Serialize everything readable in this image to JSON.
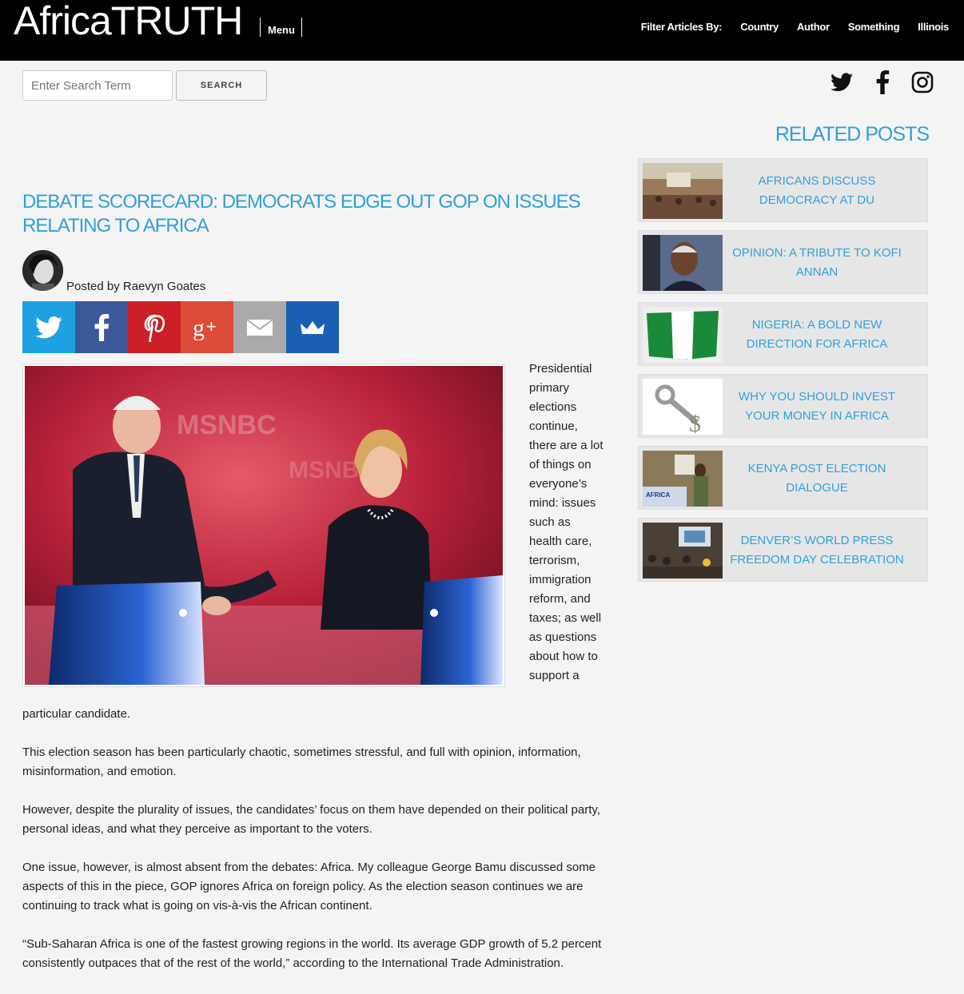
{
  "header": {
    "logo": "AfricaTRUTH",
    "menu_label": "Menu",
    "filter_label": "Filter Articles By:",
    "filters": [
      "Country",
      "Author",
      "Something",
      "Illinois"
    ]
  },
  "search": {
    "placeholder": "Enter Search Term",
    "button_label": "SEARCH"
  },
  "social_top": [
    "twitter-icon",
    "facebook-icon",
    "instagram-icon"
  ],
  "article": {
    "title": "DEBATE SCORECARD: DEMOCRATS EDGE OUT GOP ON ISSUES RELATING TO AFRICA",
    "byline": "Posted by Raevyn Goates",
    "share_buttons": [
      {
        "icon": "twitter-icon",
        "color": "#1da1e2"
      },
      {
        "icon": "facebook-icon",
        "color": "#3b5998"
      },
      {
        "icon": "pinterest-icon",
        "color": "#cb2027"
      },
      {
        "icon": "google-plus-icon",
        "color": "#dd4b39"
      },
      {
        "icon": "email-icon",
        "color": "#aaaaaa"
      },
      {
        "icon": "crown-icon",
        "color": "#1a5fb4"
      }
    ],
    "float_paragraph": "Presidential primary elections continue, there are a lot of things on everyone’s mind: issues such as health care, terrorism, immigration reform, and taxes; as well as questions about how to support a",
    "float_continuation": "particular candidate.",
    "paragraphs": [
      "This election season has been particularly chaotic, sometimes stressful, and full with opinion, information, misinformation, and emotion.",
      "However, despite the plurality of issues, the candidates’ focus on them have depended on their political party, personal ideas, and what they perceive as important to the voters.",
      "One issue, however, is almost absent from the debates: Africa. My colleague George Bamu discussed some aspects of this in the piece, GOP ignores Africa on foreign policy. As the election season continues we are continuing to track what is going on vis-à-vis the African continent.",
      "“Sub-Saharan Africa is one of the fastest growing regions in the world. Its average GDP growth of 5.2 percent consistently outpaces that of the rest of the world,” according to the International Trade Administration."
    ]
  },
  "sidebar": {
    "title": "RELATED POSTS",
    "posts": [
      {
        "title": "AFRICANS DISCUSS DEMOCRACY AT DU"
      },
      {
        "title": "OPINION: A TRIBUTE TO KOFI ANNAN"
      },
      {
        "title": "NIGERIA: A BOLD NEW DIRECTION FOR AFRICA"
      },
      {
        "title": "WHY YOU SHOULD INVEST YOUR MONEY IN AFRICA"
      },
      {
        "title": "KENYA POST ELECTION DIALOGUE"
      },
      {
        "title": "DENVER’S WORLD PRESS FREEDOM DAY CELEBRATION"
      }
    ]
  },
  "colors": {
    "accent": "#30a0d8",
    "header_bg": "#000000",
    "page_bg": "#f4f4f4"
  }
}
